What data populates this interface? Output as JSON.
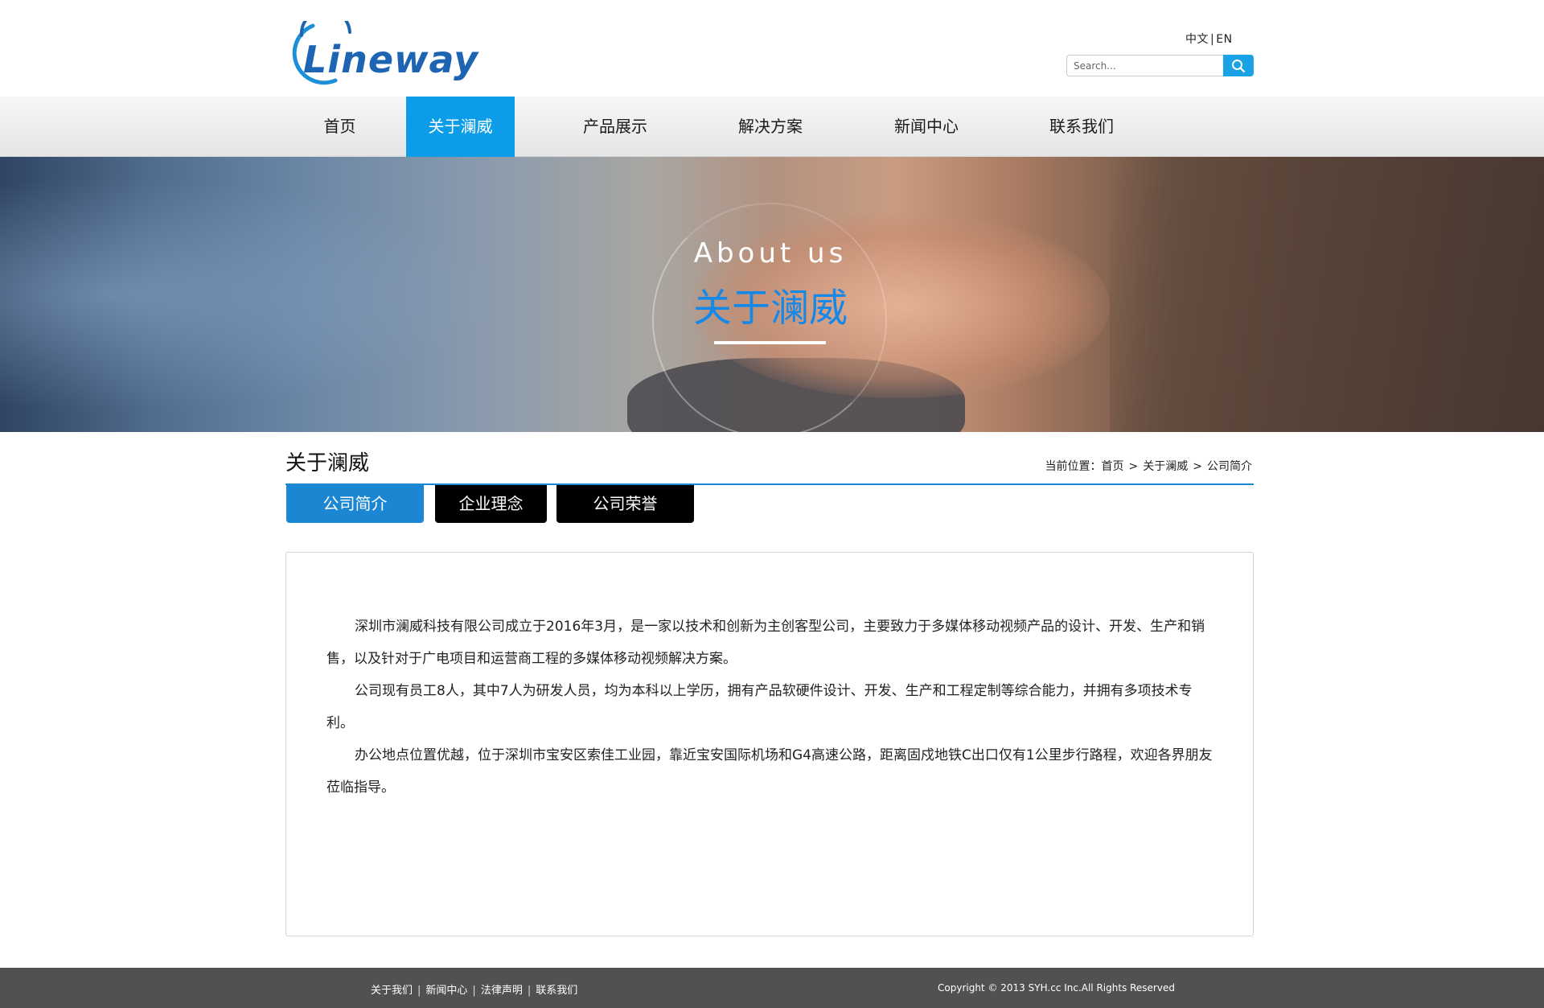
{
  "header": {
    "logo_text": "Lineway",
    "lang": {
      "zh": "中文",
      "sep": "|",
      "en": "EN"
    },
    "search": {
      "placeholder": "Search...",
      "value": ""
    },
    "search_icon": "search-icon"
  },
  "nav": {
    "items": [
      {
        "label": "首页",
        "active": false
      },
      {
        "label": "关于澜威",
        "active": true
      },
      {
        "label": "产品展示",
        "active": false
      },
      {
        "label": "解决方案",
        "active": false
      },
      {
        "label": "新闻中心",
        "active": false
      },
      {
        "label": "联系我们",
        "active": false
      }
    ],
    "active_color": "#0d9de8"
  },
  "banner": {
    "title_en": "About us",
    "title_cn": "关于澜威",
    "title_cn_color": "#1688e8"
  },
  "section": {
    "title": "关于澜威",
    "breadcrumb": {
      "prefix": "当前位置：",
      "items": [
        "首页",
        "关于澜威",
        "公司简介"
      ],
      "separator": ">"
    },
    "accent_color": "#1b87d2"
  },
  "tabs": [
    {
      "label": "公司简介",
      "active": true
    },
    {
      "label": "企业理念",
      "active": false
    },
    {
      "label": "公司荣誉",
      "active": false
    }
  ],
  "content": {
    "paragraphs": [
      "深圳市澜威科技有限公司成立于2016年3月，是一家以技术和创新为主创客型公司，主要致力于多媒体移动视频产品的设计、开发、生产和销售，以及针对于广电项目和运营商工程的多媒体移动视频解决方案。",
      "公司现有员工8人，其中7人为研发人员，均为本科以上学历，拥有产品软硬件设计、开发、生产和工程定制等综合能力，并拥有多项技术专利。",
      "办公地点位置优越，位于深圳市宝安区索佳工业园，靠近宝安国际机场和G4高速公路，距离固戍地铁C出口仅有1公里步行路程，欢迎各界朋友莅临指导。"
    ]
  },
  "footer": {
    "links": [
      "关于我们",
      "新闻中心",
      "法律声明",
      "联系我们"
    ],
    "separator": "|",
    "copyright": "Copyright © 2013 SYH.cc Inc.All Rights Reserved",
    "background": "#4f5153"
  }
}
